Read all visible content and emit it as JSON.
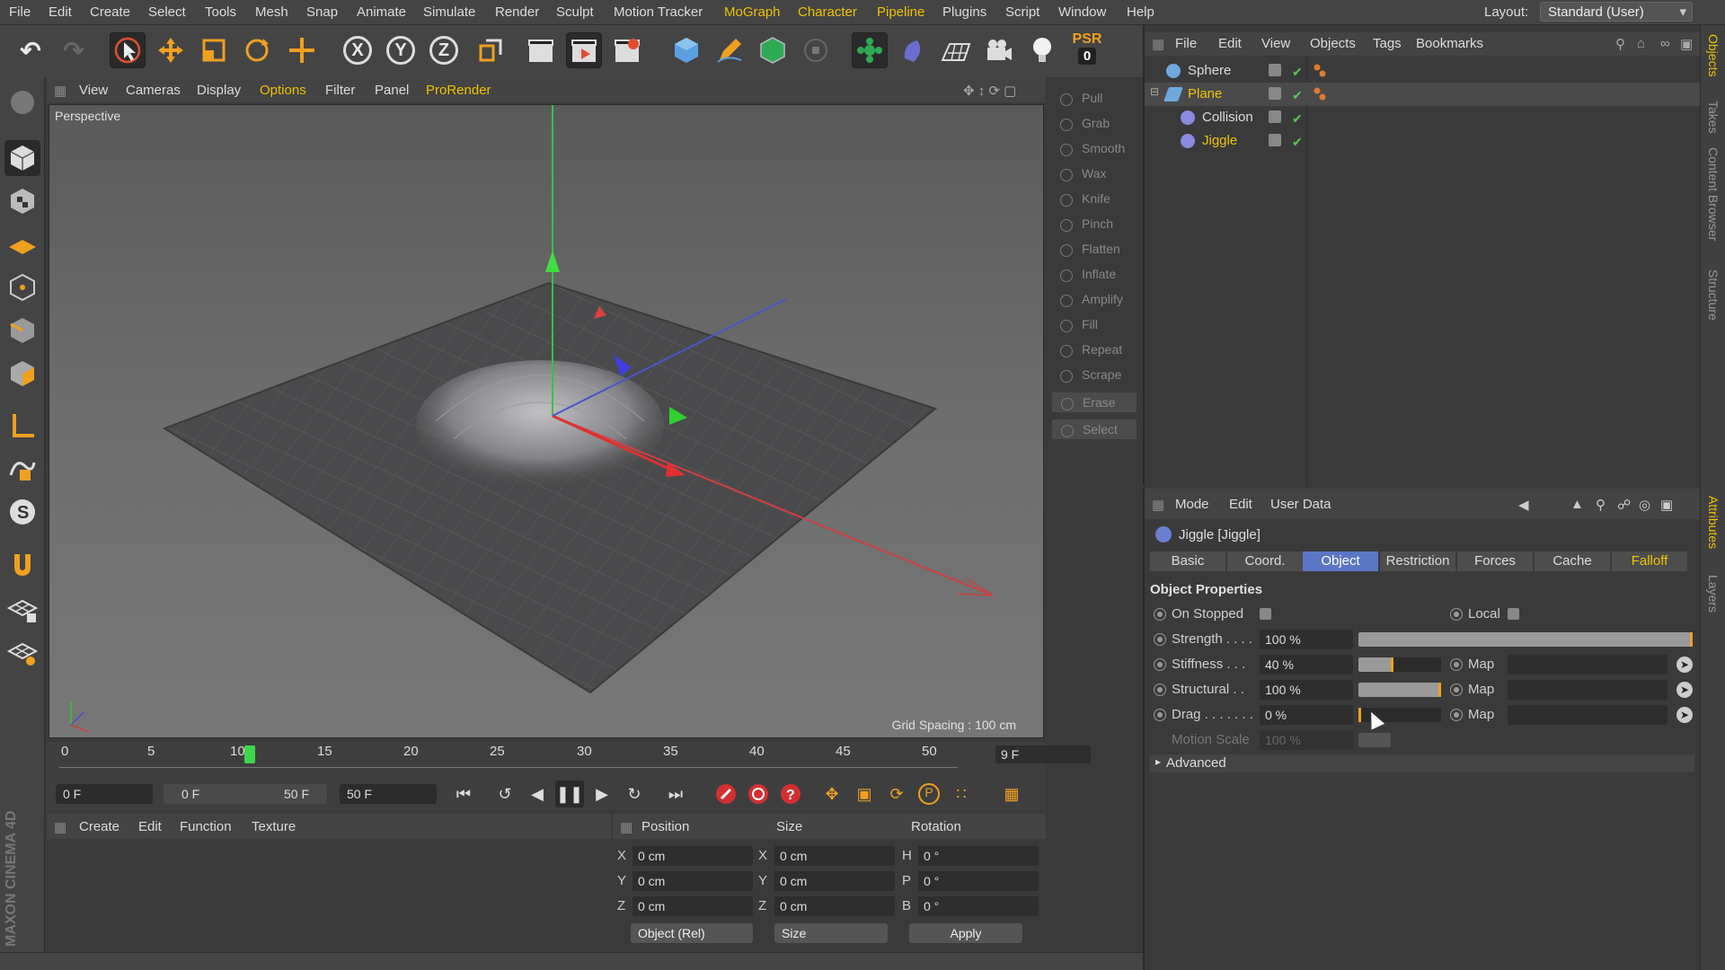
{
  "menubar": {
    "items": [
      "File",
      "Edit",
      "Create",
      "Select",
      "Tools",
      "Mesh",
      "Snap",
      "Animate",
      "Simulate",
      "Render",
      "Sculpt",
      "Motion Tracker",
      "MoGraph",
      "Character",
      "Pipeline",
      "Plugins",
      "Script",
      "Window",
      "Help"
    ],
    "highlighted": [
      "MoGraph",
      "Character",
      "Pipeline"
    ],
    "layout_label": "Layout:",
    "layout_value": "Standard (User)"
  },
  "toolbar": {
    "axis_x": "X",
    "axis_y": "Y",
    "axis_z": "Z",
    "psr_label": "PSR",
    "psr_value": "0"
  },
  "viewport": {
    "menu": [
      "View",
      "Cameras",
      "Display",
      "Options",
      "Filter",
      "Panel",
      "ProRender"
    ],
    "highlighted": [
      "Options",
      "ProRender"
    ],
    "label": "Perspective",
    "grid_spacing": "Grid Spacing : 100 cm"
  },
  "sculpt_tools": [
    "Pull",
    "Grab",
    "Smooth",
    "Wax",
    "Knife",
    "Pinch",
    "Flatten",
    "Inflate",
    "Amplify",
    "Fill",
    "Repeat",
    "Scrape",
    "Erase",
    "Select"
  ],
  "timeline": {
    "ticks": [
      "0",
      "5",
      "10",
      "15",
      "20",
      "25",
      "30",
      "35",
      "40",
      "45",
      "50"
    ],
    "current_frame": 8,
    "end_frame_display": "9 F"
  },
  "transport": {
    "start_field": "0 F",
    "range_start": "0 F",
    "range_end": "50 F",
    "end_field": "50 F"
  },
  "material_panel": {
    "menu": [
      "Create",
      "Edit",
      "Function",
      "Texture"
    ]
  },
  "coord_panel": {
    "headers": [
      "Position",
      "Size",
      "Rotation"
    ],
    "rows": [
      {
        "axis": "X",
        "pos": "0 cm",
        "size_axis": "X",
        "size": "0 cm",
        "rot_axis": "H",
        "rot": "0 °"
      },
      {
        "axis": "Y",
        "pos": "0 cm",
        "size_axis": "Y",
        "size": "0 cm",
        "rot_axis": "P",
        "rot": "0 °"
      },
      {
        "axis": "Z",
        "pos": "0 cm",
        "size_axis": "Z",
        "size": "0 cm",
        "rot_axis": "B",
        "rot": "0 °"
      }
    ],
    "mode_select": "Object (Rel)",
    "size_select": "Size",
    "apply_label": "Apply"
  },
  "object_manager": {
    "menu": [
      "File",
      "Edit",
      "View",
      "Objects",
      "Tags",
      "Bookmarks"
    ],
    "objects": [
      {
        "name": "Sphere",
        "icon_color": "#6fa8dc",
        "highlight": false,
        "indent": 0
      },
      {
        "name": "Plane",
        "icon_color": "#6fa8dc",
        "highlight": true,
        "indent": 0
      },
      {
        "name": "Collision",
        "icon_color": "#8a8ae0",
        "highlight": false,
        "indent": 1
      },
      {
        "name": "Jiggle",
        "icon_color": "#8a8ae0",
        "highlight": true,
        "indent": 1
      }
    ]
  },
  "attribute_manager": {
    "menu": [
      "Mode",
      "Edit",
      "User Data"
    ],
    "title": "Jiggle [Jiggle]",
    "tabs": [
      "Basic",
      "Coord.",
      "Object",
      "Restriction",
      "Forces",
      "Cache",
      "Falloff"
    ],
    "active_tab": "Object",
    "section": "Object Properties",
    "on_stopped_label": "On Stopped",
    "local_label": "Local",
    "strength_label": "Strength . . . .",
    "strength_value": "100 %",
    "strength_fraction": 1.0,
    "stiffness_label": "Stiffness . . .",
    "stiffness_value": "40 %",
    "stiffness_fraction": 0.4,
    "structural_label": "Structural . .",
    "structural_value": "100 %",
    "structural_fraction": 1.0,
    "drag_label": "Drag . . . . . . .",
    "drag_value": "0 %",
    "drag_fraction": 0.0,
    "motion_scale_label": "Motion Scale",
    "motion_scale_value": "100 %",
    "map_label": "Map",
    "advanced_label": "Advanced"
  },
  "right_strip": {
    "tabs": [
      "Objects",
      "Takes",
      "Content Browser",
      "Structure",
      "Attributes",
      "Layers"
    ]
  },
  "colors": {
    "accent": "#f0c300",
    "active_tab": "#5b76c4",
    "bg": "#3a3a3a"
  }
}
